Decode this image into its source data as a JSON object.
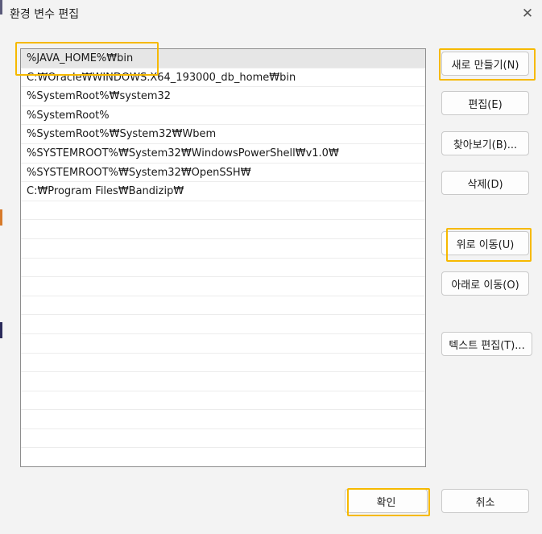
{
  "window": {
    "title": "환경 변수 편집",
    "close_icon": "close-icon"
  },
  "list": {
    "items": [
      "%JAVA_HOME%₩bin",
      "C:₩Oracle₩WINDOWS.X64_193000_db_home₩bin",
      "%SystemRoot%₩system32",
      "%SystemRoot%",
      "%SystemRoot%₩System32₩Wbem",
      "%SYSTEMROOT%₩System32₩WindowsPowerShell₩v1.0₩",
      "%SYSTEMROOT%₩System32₩OpenSSH₩",
      "C:₩Program Files₩Bandizip₩",
      "",
      "",
      "",
      "",
      "",
      "",
      "",
      "",
      "",
      "",
      "",
      "",
      "",
      ""
    ],
    "selected_index": 0
  },
  "buttons": {
    "new": "새로 만들기(N)",
    "edit": "편집(E)",
    "browse": "찾아보기(B)...",
    "delete": "삭제(D)",
    "move_up": "위로 이동(U)",
    "move_down": "아래로 이동(O)",
    "edit_text": "텍스트 편집(T)...",
    "ok": "확인",
    "cancel": "취소"
  },
  "colors": {
    "highlight": "#f6b900",
    "dialog_bg": "#f3f3f3",
    "selected_row": "#e6e6e6"
  }
}
